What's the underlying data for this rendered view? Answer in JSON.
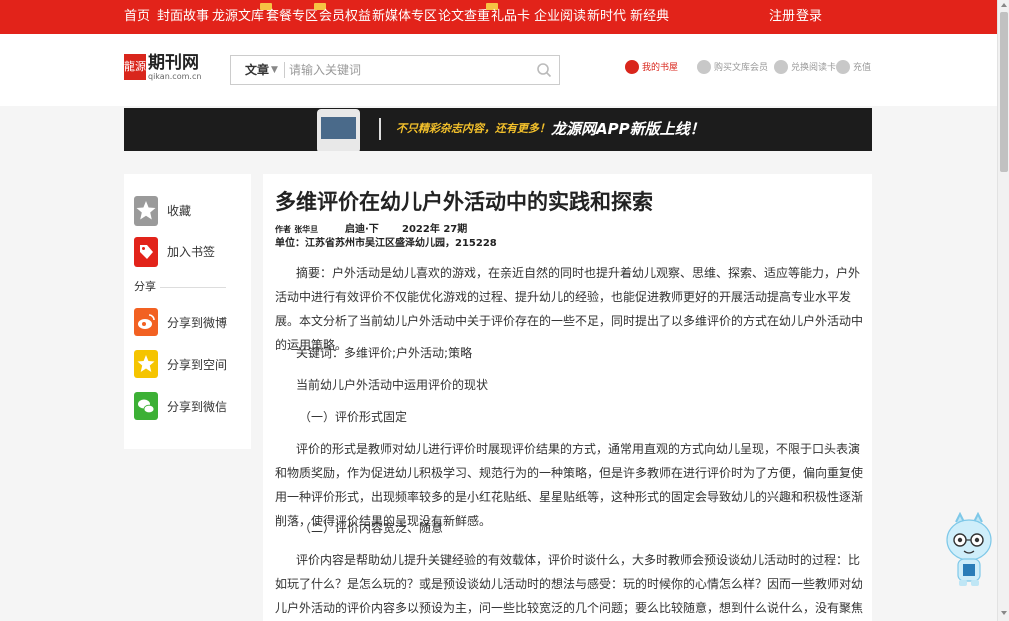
{
  "nav": {
    "items": [
      "首页",
      "封面故事",
      "龙源文库",
      "套餐专区",
      "会员权益",
      "新媒体专区",
      "论文查重",
      "礼品卡",
      "企业阅读",
      "新时代 新经典"
    ],
    "register": "注册",
    "login": "登录",
    "brand_color": "#e2231a"
  },
  "header": {
    "logo_mark": "龍源",
    "logo_name": "期刊网",
    "logo_domain": "qikan.com.cn",
    "search_type": "文章",
    "search_placeholder": "请输入关键词",
    "my_shelf": "我的书屋",
    "buy_vip": "购买文库会员",
    "redeem_card": "兑换阅读卡",
    "recharge": "充值"
  },
  "banner": {
    "message": "不只精彩杂志内容，还有更多！",
    "app_text": "龙源网APP新版上线！"
  },
  "sidebar": {
    "favorite": "收藏",
    "bookmark": "加入书签",
    "share_title": "分享",
    "share_weibo": "分享到微博",
    "share_qzone": "分享到空间",
    "share_wechat": "分享到微信"
  },
  "article": {
    "title": "多维评价在幼儿户外活动中的实践和探索",
    "author_label": "作者",
    "author": "张华旦",
    "journal": "启迪·下",
    "issue": "2022年 27期",
    "unit": "单位：江苏省苏州市吴江区盛泽幼儿园，215228",
    "abstract": "摘要：户外活动是幼儿喜欢的游戏，在亲近自然的同时也提升着幼儿观察、思维、探索、适应等能力，户外活动中进行有效评价不仅能优化游戏的过程、提升幼儿的经验，也能促进教师更好的开展活动提高专业水平发展。本文分析了当前幼儿户外活动中关于评价存在的一些不足，同时提出了以多维评价的方式在幼儿户外活动中的运用策略。",
    "keywords": "关键词：多维评价;户外活动;策略",
    "section1": "当前幼儿户外活动中运用评价的现状",
    "sub1": "（一）评价形式固定",
    "para1": "评价的形式是教师对幼儿进行评价时展现评价结果的方式，通常用直观的方式向幼儿呈现，不限于口头表演和物质奖励，作为促进幼儿积极学习、规范行为的一种策略，但是许多教师在进行评价时为了方便，偏向重复使用一种评价形式，出现频率较多的是小红花贴纸、星星贴纸等，这种形式的固定会导致幼儿的兴趣和积极性逐渐削落，使得评价结果的呈现没有新鲜感。",
    "sub2": "（二）评价内容宽泛、随意",
    "para2": "评价内容是帮助幼儿提升关键经验的有效载体，评价时谈什么，大多时教师会预设谈幼儿活动时的过程：比如玩了什么？是怎么玩的？或是预设谈幼儿活动时的想法与感受：玩的时候你的心情怎么样？因而一些教师对幼儿户外活动的评价内容多以预设为主，问一些比较宽泛的几个问题；要么比较随意，想到什么说什么，没有聚焦某一个或几个有价值的点来展开，对于"
  }
}
